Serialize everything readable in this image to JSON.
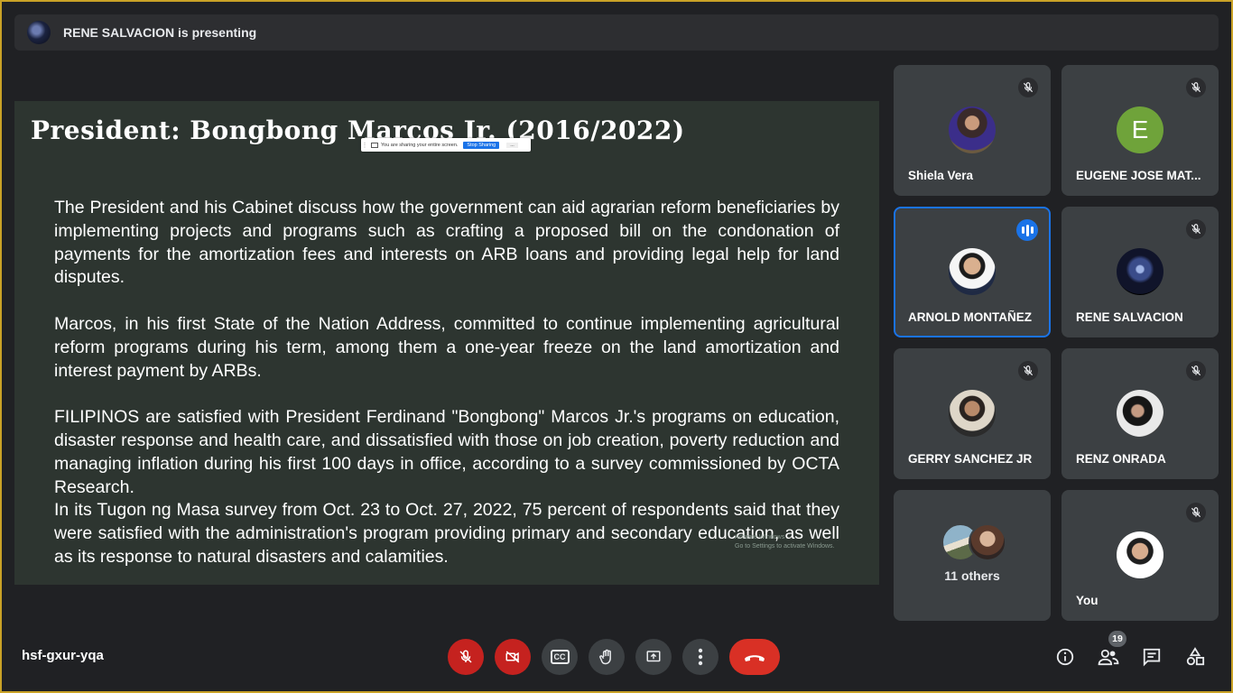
{
  "presenting": {
    "text": "RENE SALVACION is presenting"
  },
  "slide": {
    "title": "President: Bongbong Marcos Jr. (2016/2022)",
    "paragraphs": [
      "The President and his Cabinet discuss how the government can aid agrarian reform beneficiaries by implementing projects and programs such as crafting a proposed bill on the condonation of payments for the amortization fees and interests on ARB loans and providing legal help for land disputes.",
      "Marcos, in his first State of the Nation Address, committed to continue implementing agricultural reform programs during his term, among them a one-year freeze on the land amortization and interest payment by ARBs.",
      "FILIPINOS are satisfied with President Ferdinand \"Bongbong\" Marcos Jr.'s programs on education, disaster response and health care, and dissatisfied with those on job creation, poverty reduction and managing inflation during his first 100 days in office, according to a survey commissioned by OCTA Research.",
      "In its Tugon ng Masa survey from Oct. 23 to Oct. 27, 2022, 75 percent of respondents said that they were satisfied with the administration's program providing primary and secondary education, as well as its response to natural disasters and calamities."
    ],
    "share_notice": {
      "text": "You are sharing your entire screen.",
      "stop_label": "Stop Sharing",
      "more_label": "..."
    },
    "watermark": {
      "line1": "Activate Windows",
      "line2": "Go to Settings to activate Windows."
    }
  },
  "participants": [
    {
      "name": "Shiela Vera",
      "letter": ""
    },
    {
      "name": "EUGENE JOSE MAT...",
      "letter": "E"
    },
    {
      "name": "ARNOLD MONTAÑEZ",
      "letter": ""
    },
    {
      "name": "RENE SALVACION",
      "letter": ""
    },
    {
      "name": "GERRY SANCHEZ JR",
      "letter": ""
    },
    {
      "name": "RENZ ONRADA",
      "letter": ""
    },
    {
      "name": "You",
      "letter": ""
    }
  ],
  "others": {
    "label": "11 others"
  },
  "meeting": {
    "code": "hsf-gxur-yqa",
    "participant_count": "19"
  },
  "controls": {
    "captions_label": "CC"
  },
  "colors": {
    "background": "#202124",
    "tile": "#3c4043",
    "slide_bg": "#2d3530",
    "accent_blue": "#1a73e8",
    "mic_off_red": "#c5221f",
    "end_call_red": "#d93025"
  }
}
